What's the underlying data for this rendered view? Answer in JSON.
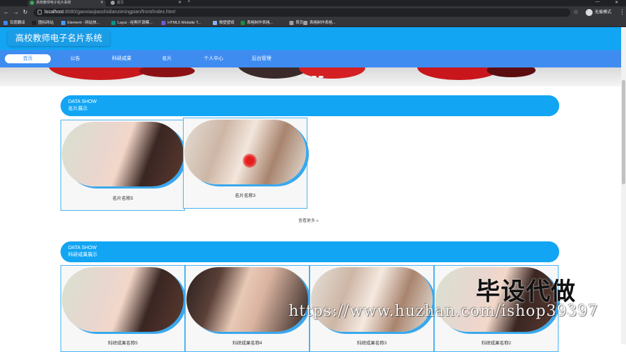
{
  "browser": {
    "tabs": [
      {
        "title": "高校教师电子名片系统"
      },
      {
        "title": "首页"
      }
    ],
    "new_tab": "+",
    "window_min": "—",
    "window_close": "✕",
    "url_host": "localhost",
    "url_path": ":8080/gaoxiaojiaoshidianzimingpian/front/index.html",
    "profile_label": "无痕模式",
    "bookmarks": [
      {
        "label": "百度翻译",
        "color": "#4285f4"
      },
      {
        "label": "图标网站",
        "color": "#202124"
      },
      {
        "label": "Element - 网站快...",
        "color": "#409eff"
      },
      {
        "label": "Layui - 经典开源模...",
        "color": "#009688"
      },
      {
        "label": "HTML5 Website T...",
        "color": "#6b5bd6"
      },
      {
        "label": "微壁壁纸",
        "color": "#8ab4f8"
      },
      {
        "label": "表格制作表格...",
        "color": "#1e8e3e"
      },
      {
        "label": "首页",
        "color": "#9aa0a6"
      },
      {
        "label": "表格制作表格...",
        "color": "#9aa0a6"
      }
    ]
  },
  "site": {
    "title": "高校教师电子名片系统",
    "nav": [
      {
        "label": "首页",
        "active": true
      },
      {
        "label": "公告",
        "active": false
      },
      {
        "label": "科研成果",
        "active": false
      },
      {
        "label": "名片",
        "active": false
      },
      {
        "label": "个人中心",
        "active": false
      },
      {
        "label": "后台管理",
        "active": false
      }
    ]
  },
  "sections": [
    {
      "en": "DATA SHOW",
      "cn": "名片展示",
      "cards": [
        {
          "caption": "名片名称5"
        },
        {
          "caption": "名片名称3"
        }
      ],
      "more": "查看更多 »"
    },
    {
      "en": "DATA SHOW",
      "cn": "科研成果展示",
      "cards": [
        {
          "caption": "科研成果名称5"
        },
        {
          "caption": "科研成果名称4"
        },
        {
          "caption": "科研成果名称3"
        },
        {
          "caption": "科研成果名称2"
        }
      ]
    }
  ],
  "watermark": {
    "big": "毕设代做",
    "url": "https://www.huzhan.com/ishop39397"
  },
  "colors": {
    "header": "#12a5f4",
    "navbar": "#3f8cf1",
    "card_border": "#48b4f2"
  }
}
